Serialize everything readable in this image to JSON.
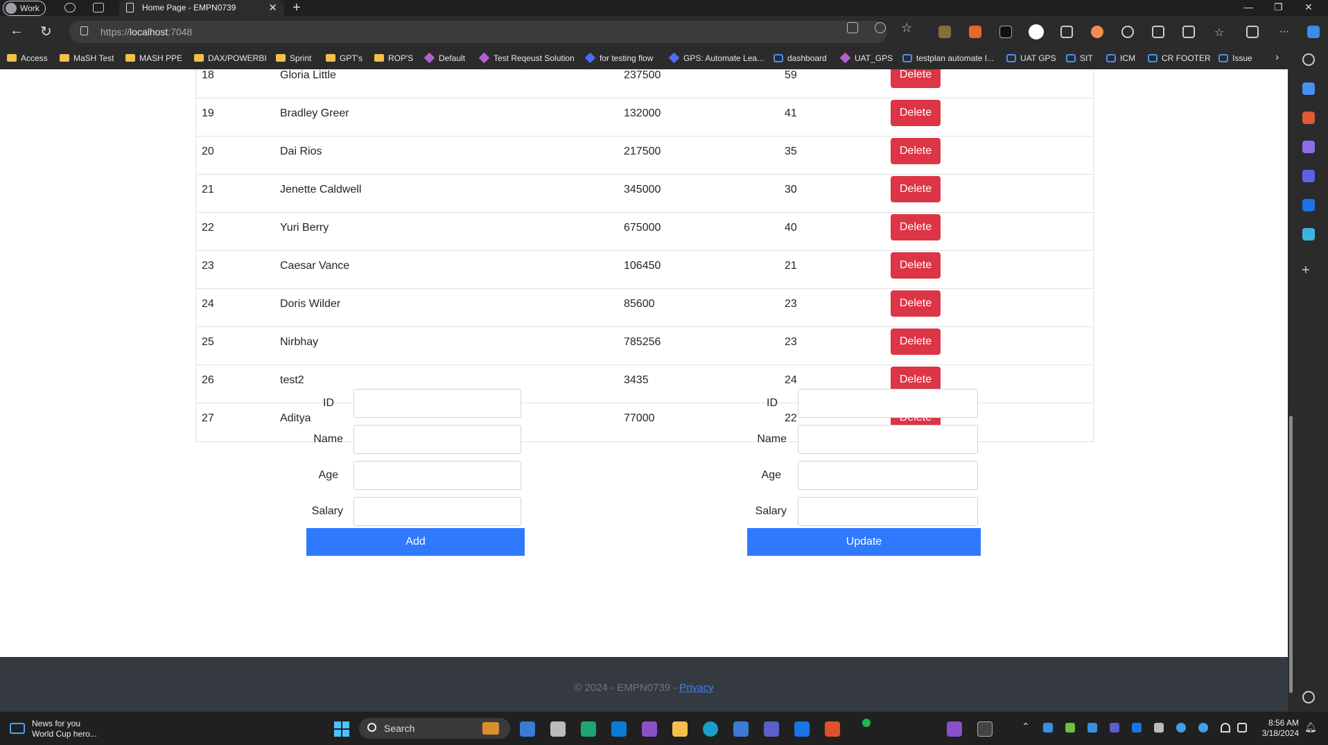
{
  "browser": {
    "profile_label": "Work",
    "tab_title": "Home Page - EMPN0739",
    "url_prefix": "https://",
    "url_host": "localhost",
    "url_port": ":7048",
    "bookmarks": [
      "Access",
      "MaSH Test",
      "MASH PPE",
      "DAX/POWERBI",
      "Sprint",
      "GPT's",
      "ROP'S",
      "Default",
      "Test Reqeust Solution",
      "for testing flow",
      "GPS: Automate Lea...",
      "dashboard",
      "UAT_GPS",
      "testplan automate I...",
      "UAT GPS",
      "SIT",
      "ICM",
      "CR FOOTER",
      "Issue"
    ]
  },
  "table": {
    "rows": [
      {
        "id": "18",
        "name": "Gloria Little",
        "salary": "237500",
        "age": "59"
      },
      {
        "id": "19",
        "name": "Bradley Greer",
        "salary": "132000",
        "age": "41"
      },
      {
        "id": "20",
        "name": "Dai Rios",
        "salary": "217500",
        "age": "35"
      },
      {
        "id": "21",
        "name": "Jenette Caldwell",
        "salary": "345000",
        "age": "30"
      },
      {
        "id": "22",
        "name": "Yuri Berry",
        "salary": "675000",
        "age": "40"
      },
      {
        "id": "23",
        "name": "Caesar Vance",
        "salary": "106450",
        "age": "21"
      },
      {
        "id": "24",
        "name": "Doris Wilder",
        "salary": "85600",
        "age": "23"
      },
      {
        "id": "25",
        "name": "Nirbhay",
        "salary": "785256",
        "age": "23"
      },
      {
        "id": "26",
        "name": "test2",
        "salary": "3435",
        "age": "24"
      },
      {
        "id": "27",
        "name": "Aditya",
        "salary": "77000",
        "age": "22"
      }
    ],
    "delete_label": "Delete"
  },
  "add_form": {
    "labels": {
      "id": "ID",
      "name": "Name",
      "age": "Age",
      "salary": "Salary"
    },
    "button": "Add"
  },
  "update_form": {
    "labels": {
      "id": "ID",
      "name": "Name",
      "age": "Age",
      "salary": "Salary"
    },
    "button": "Update"
  },
  "footer": {
    "text": "© 2024 - EMPN0739 - ",
    "privacy_link": "Privacy"
  },
  "taskbar": {
    "news_title": "News for you",
    "news_sub": "World Cup hero...",
    "search_label": "Search",
    "time": "8:56 AM",
    "date": "3/18/2024"
  }
}
